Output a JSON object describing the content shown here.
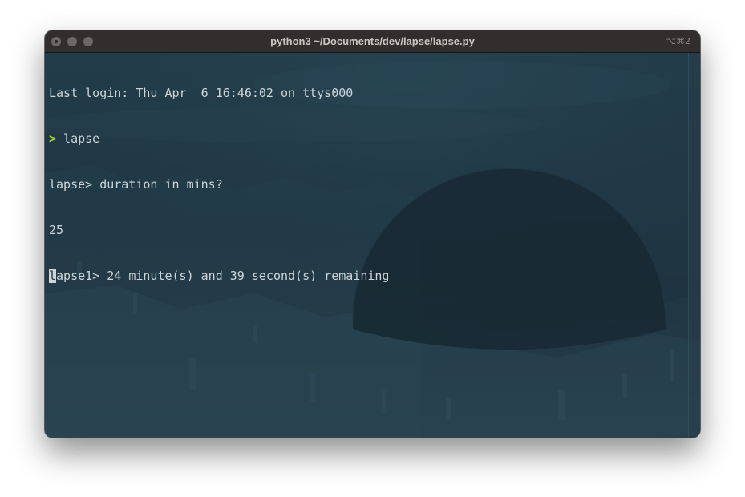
{
  "window": {
    "title": "python3 ~/Documents/dev/lapse/lapse.py",
    "shortcut": "⌥⌘2"
  },
  "terminal": {
    "lines": {
      "login": "Last login: Thu Apr  6 16:46:02 on ttys000",
      "command_prompt": ">",
      "command": " lapse",
      "question": "lapse> duration in mins?",
      "answer": "25",
      "status_cursor_char": "l",
      "status_rest": "apse1> 24 minute(s) and 39 second(s) remaining"
    }
  },
  "colors": {
    "background": "#1f3440",
    "text": "#cdd5d8",
    "prompt_arrow": "#9bd534",
    "titlebar": "#322e2d"
  },
  "icons": {
    "traffic_lights": [
      "close-button-icon",
      "minimize-button-icon",
      "zoom-button-icon"
    ]
  }
}
